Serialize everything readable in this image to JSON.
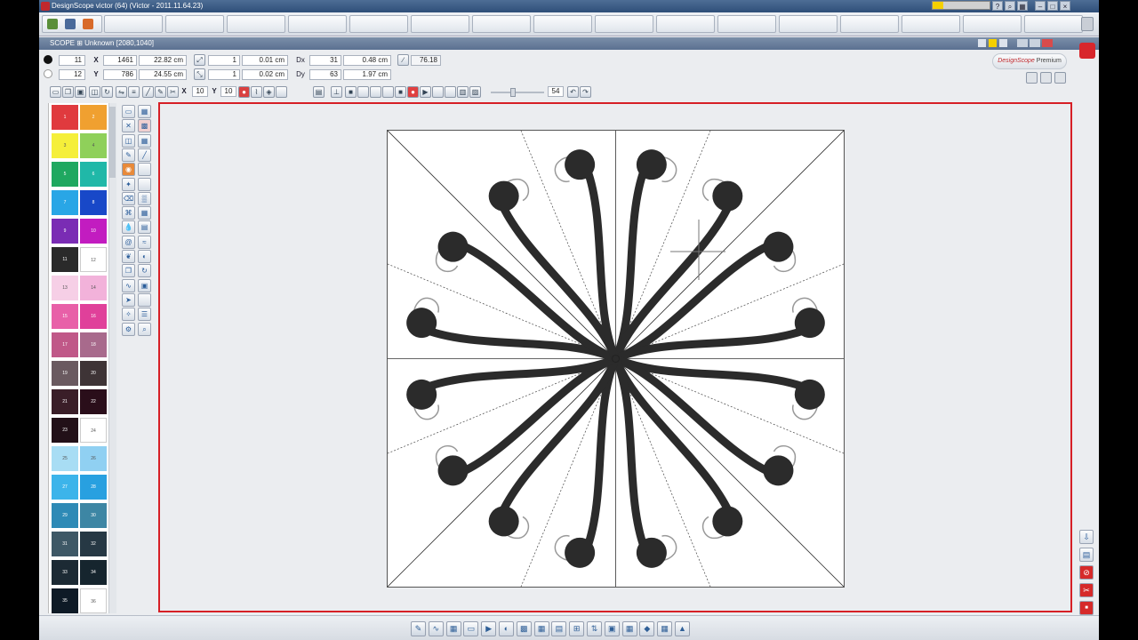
{
  "window": {
    "title": "DesignScope victor (64) (Victor - 2011.11.64.23)",
    "subtitle": "SCOPE ⊞ Unknown [2080,1040]"
  },
  "brand": {
    "name": "DesignScope",
    "edition": "Premium"
  },
  "coords": {
    "row1": {
      "layer": "11",
      "x_px": "1461",
      "x_cm": "22.82 cm",
      "scale_x": "1",
      "scale_x_cm": "0.01 cm",
      "dx_label": "Dx",
      "dx": "31",
      "dx_cm": "0.48 cm",
      "angle": "76.18"
    },
    "row2": {
      "layer": "12",
      "y_px": "786",
      "y_cm": "24.55 cm",
      "scale_y": "1",
      "scale_y_cm": "0.02 cm",
      "dy_label": "Dy",
      "dy": "63",
      "dy_cm": "1.97 cm"
    },
    "x_label": "X",
    "y_label": "Y"
  },
  "toolbar": {
    "x_label": "X",
    "x_value": "10",
    "y_label": "Y",
    "y_value": "10",
    "zoom_value": "54"
  },
  "palette": [
    {
      "n": "1",
      "c": "#e03a3e"
    },
    {
      "n": "2",
      "c": "#f0a030"
    },
    {
      "n": "3",
      "c": "#f5ef3a"
    },
    {
      "n": "4",
      "c": "#8fd05a"
    },
    {
      "n": "5",
      "c": "#1fa860"
    },
    {
      "n": "6",
      "c": "#20b8a8"
    },
    {
      "n": "7",
      "c": "#29a6e6"
    },
    {
      "n": "8",
      "c": "#1848c8"
    },
    {
      "n": "9",
      "c": "#7a2cb4"
    },
    {
      "n": "10",
      "c": "#c21cc0"
    },
    {
      "n": "11",
      "c": "#2a2a2a"
    },
    {
      "n": "12",
      "c": "#ffffff"
    },
    {
      "n": "13",
      "c": "#f6cfe6"
    },
    {
      "n": "14",
      "c": "#f2b2da"
    },
    {
      "n": "15",
      "c": "#e860a8"
    },
    {
      "n": "16",
      "c": "#e0409a"
    },
    {
      "n": "17",
      "c": "#c05888"
    },
    {
      "n": "18",
      "c": "#a86a8c"
    },
    {
      "n": "19",
      "c": "#6a5a60"
    },
    {
      "n": "20",
      "c": "#3e3436"
    },
    {
      "n": "21",
      "c": "#3a1e28"
    },
    {
      "n": "22",
      "c": "#2a0e1a"
    },
    {
      "n": "23",
      "c": "#221018"
    },
    {
      "n": "24",
      "c": "#ffffff"
    },
    {
      "n": "25",
      "c": "#a8ddf4"
    },
    {
      "n": "26",
      "c": "#90d0f2"
    },
    {
      "n": "27",
      "c": "#3cb4ea"
    },
    {
      "n": "28",
      "c": "#28a0e0"
    },
    {
      "n": "29",
      "c": "#2e8ab6"
    },
    {
      "n": "30",
      "c": "#3d86a4"
    },
    {
      "n": "31",
      "c": "#3e5866"
    },
    {
      "n": "32",
      "c": "#263844"
    },
    {
      "n": "33",
      "c": "#1c2a34"
    },
    {
      "n": "34",
      "c": "#16252e"
    },
    {
      "n": "35",
      "c": "#0e1a26"
    },
    {
      "n": "36",
      "c": "#ffffff"
    }
  ],
  "colors": {
    "frame": "#d61f26",
    "motif": "#2b2b2b",
    "accent_yellow": "#f5d000"
  }
}
